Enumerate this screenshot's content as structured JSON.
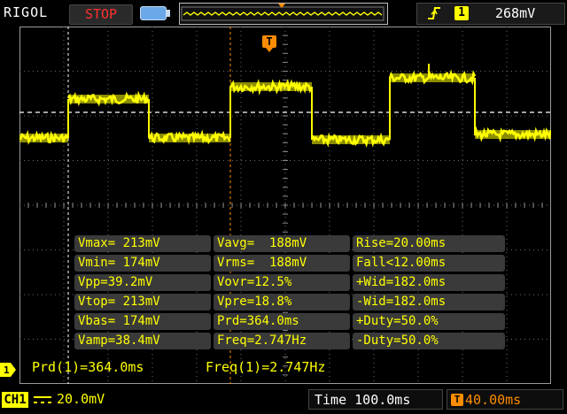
{
  "header": {
    "brand": "RIGOL",
    "run_state": "STOP",
    "trigger_source": "1",
    "trigger_level": "268mV"
  },
  "markers": {
    "trigger_position_label": "T",
    "channel_marker_label": "1"
  },
  "measurements": {
    "rows": [
      [
        "Vmax= 213mV",
        "Vavg=  188mV",
        "Rise=20.00ms"
      ],
      [
        "Vmin= 174mV",
        "Vrms=  188mV",
        "Fall<12.00ms"
      ],
      [
        "Vpp=39.2mV",
        "Vovr=12.5%",
        "+Wid=182.0ms"
      ],
      [
        "Vtop= 213mV",
        "Vpre=18.8%",
        "-Wid=182.0ms"
      ],
      [
        "Vbas= 174mV",
        "Prd=364.0ms",
        "+Duty=50.0%"
      ],
      [
        "Vamp=38.4mV",
        "Freq=2.747Hz",
        "-Duty=50.0%"
      ]
    ]
  },
  "stats": {
    "period": "Prd(1)=364.0ms",
    "frequency": "Freq(1)=2.747Hz"
  },
  "footer": {
    "channel": "CH1",
    "channel_scale": "20.0mV",
    "timebase": "Time 100.0ms",
    "trigger_offset": "40.00ms"
  },
  "colors": {
    "trace": "#ffff00",
    "trigger_marker": "#ff8c00",
    "run_state": "#ff3030"
  },
  "icons": {
    "edge": "rising-edge-icon",
    "battery": "battery-icon",
    "coupling": "dc-coupling-icon"
  }
}
